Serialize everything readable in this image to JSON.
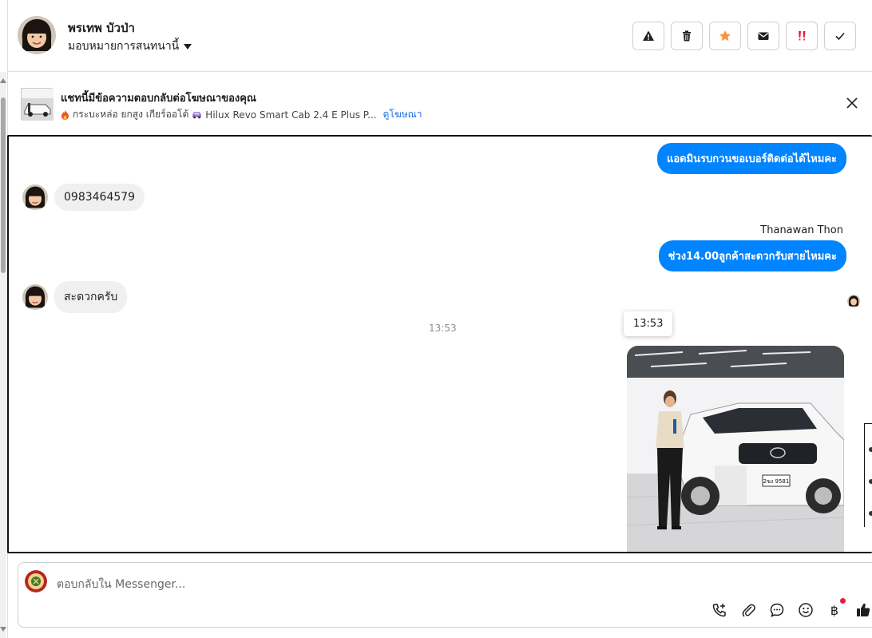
{
  "header": {
    "contact_name": "พรเทพ บัวป่า",
    "assign_label": "มอบหมายการสนทนานี้",
    "actions": [
      {
        "name": "report-button",
        "icon": "warning-icon"
      },
      {
        "name": "delete-button",
        "icon": "trash-icon"
      },
      {
        "name": "star-button",
        "icon": "star-icon"
      },
      {
        "name": "mark-unread-button",
        "icon": "envelope-icon"
      },
      {
        "name": "follow-up-button",
        "icon": "priority-icon"
      },
      {
        "name": "done-button",
        "icon": "check-icon"
      }
    ]
  },
  "ad": {
    "title": "แชทนี้มีข้อความตอบกลับต่อโฆษณาของคุณ",
    "subtitle": "กระบะหล่อ ยกสูง เกียร์ออโต้",
    "car_name": "Hilux Revo Smart Cab 2.4 E Plus P...",
    "link": "ดูโฆษณา"
  },
  "conversation": {
    "messages": [
      {
        "side": "out",
        "text": "แอดมินรบกวนขอเบอร์ติดต่อได้ไหมคะ"
      },
      {
        "side": "in",
        "text": "0983464579"
      },
      {
        "side": "out",
        "sender": "Thanawan Thon",
        "text": "ช่วง14.00ลูกค้าสะดวกรับสายไหมคะ"
      },
      {
        "side": "in",
        "text": "สะดวกครับ"
      }
    ],
    "time_divider": "13:53",
    "tooltip_time": "13:53",
    "plate_text": "2ขง 9581"
  },
  "composer": {
    "placeholder": "ตอบกลับใน Messenger...",
    "tools": [
      "call-add-icon",
      "paperclip-icon",
      "chat-bubble-icon",
      "emoji-icon",
      "baht-icon",
      "thumbs-up-icon"
    ],
    "baht_symbol": "฿"
  },
  "colors": {
    "accent": "#0084ff",
    "link": "#216fdb",
    "star": "#f7923b",
    "priority": "#e41e3f"
  }
}
